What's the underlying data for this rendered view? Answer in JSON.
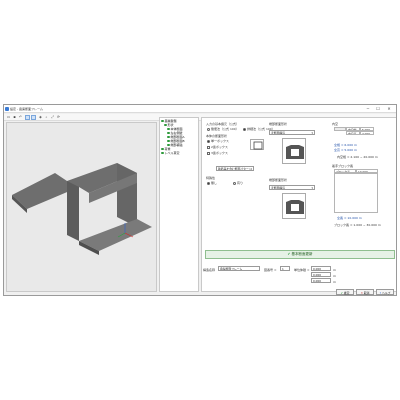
{
  "window": {
    "title": "設定 - 函渠断面フレーム",
    "minimize": "─",
    "maximize": "☐",
    "close": "✕"
  },
  "toolbar": {
    "icons": [
      "folder-icon",
      "save-icon",
      "undo-icon",
      "view-front-icon",
      "view-side-icon",
      "view-3d-icon",
      "zoom-icon",
      "fit-icon",
      "rotate-icon"
    ]
  },
  "tree": {
    "items": [
      {
        "label": "基本条件",
        "level": 0,
        "selected": true
      },
      {
        "label": "形状",
        "level": 1
      },
      {
        "label": "本体断面",
        "level": 2
      },
      {
        "label": "左右側壁",
        "level": 2
      },
      {
        "label": "端部断面A",
        "level": 2
      },
      {
        "label": "端部断面B",
        "level": 2
      },
      {
        "label": "端部補強",
        "level": 2
      },
      {
        "label": "荷重",
        "level": 0
      },
      {
        "label": "レベル算定",
        "level": 0
      }
    ]
  },
  "form": {
    "input_method_label": "入力の基本諸元（公式）",
    "input_method_options": [
      "簡便法（公式 100）",
      "詳細法（公式 100）"
    ],
    "shape_label": "本体の断面形状",
    "shape_options": [
      "単一ボックス",
      "2連ボックス",
      "3連ボックス"
    ],
    "shape_combo": "鉄筋等を含む断面パターン",
    "section_label": "特殊性",
    "section_options": [
      "無し",
      "有り"
    ],
    "end_a_label": "端部断面形状",
    "end_a_combo": "変断面構造",
    "end_b_label": "端部断面形状",
    "end_b_combo": "変断面構造",
    "dims_label": "内空",
    "dims_headers": [
      "",
      "内空幅",
      "内空高"
    ],
    "dims_values": [
      "5.000",
      "4.000"
    ],
    "dims_width_label": "全幅 = 6.000 m",
    "dims_height_label": "全高 = 5.000 m",
    "dims_note": "内空幅 = 2.100 ~ 20.000 m",
    "block_label": "着手ブロック長",
    "block_header": "ブロック長",
    "block_value": "10.000",
    "block_total": "全長 = 10.000 m",
    "block_note": "ブロック長 = 1.000 ~ 30.000 m"
  },
  "action_button": "基本断面更新",
  "footer": {
    "name_label": "構造名称",
    "name_value": "函渠断面フレーム",
    "count_label": "図番号 =",
    "count_value": "1",
    "field1_label": "単位体積 =",
    "field1_value": "0.000",
    "field2_value": "0.000",
    "field3_value": "0.000",
    "unit": "m",
    "ok": "確定",
    "cancel": "取消",
    "help": "ヘルプ"
  }
}
